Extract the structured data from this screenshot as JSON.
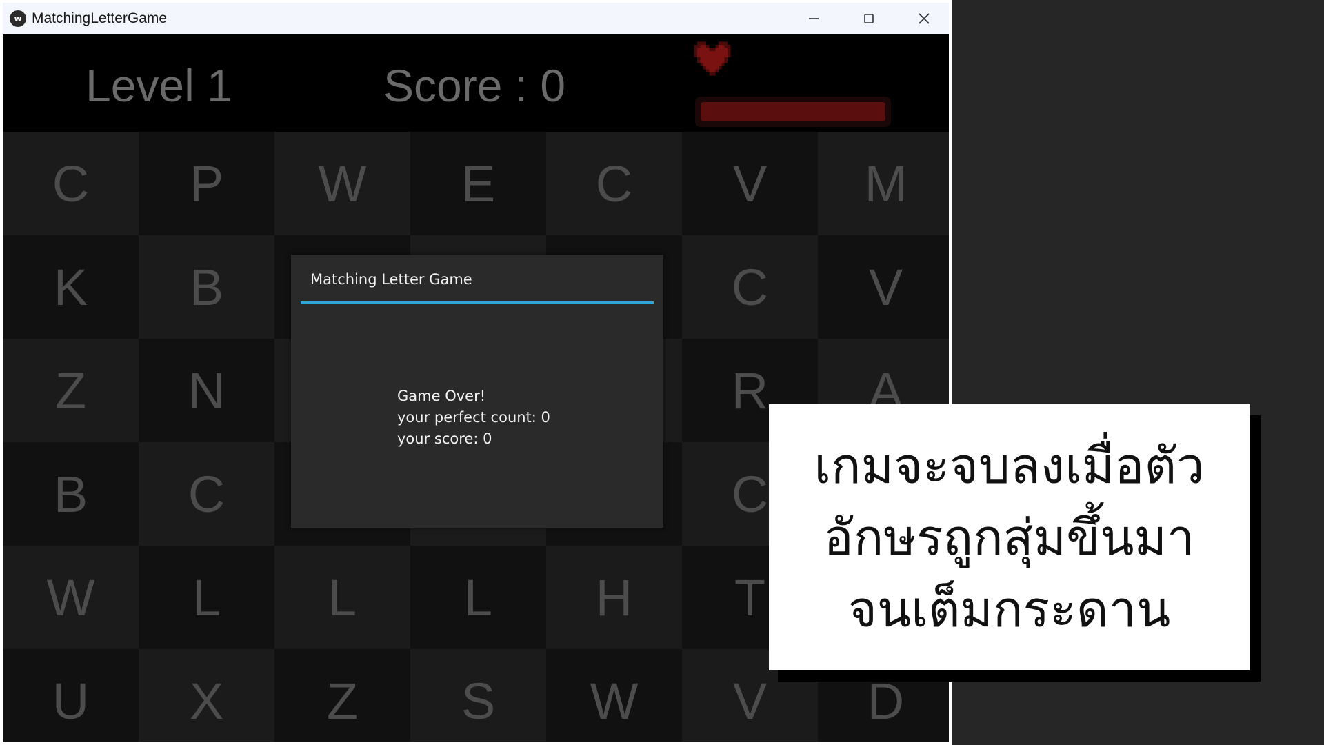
{
  "window": {
    "title": "MatchingLetterGame",
    "icon": "app-logo-icon",
    "controls": [
      "minimize-icon",
      "maximize-icon",
      "close-icon"
    ]
  },
  "hud": {
    "level": "Level 1",
    "score": "Score : 0",
    "heart_icon": "heart-icon"
  },
  "grid": {
    "rows": [
      [
        "C",
        "P",
        "W",
        "E",
        "C",
        "V",
        "M"
      ],
      [
        "K",
        "B",
        "",
        "",
        "",
        "C",
        "V"
      ],
      [
        "Z",
        "N",
        "",
        "",
        "",
        "R",
        "A"
      ],
      [
        "B",
        "C",
        "",
        "",
        "",
        "C",
        ""
      ],
      [
        "W",
        "L",
        "L",
        "L",
        "H",
        "T",
        ""
      ],
      [
        "U",
        "X",
        "Z",
        "S",
        "W",
        "V",
        "D"
      ]
    ]
  },
  "dialog": {
    "title": "Matching Letter Game",
    "message_line1": "Game Over!",
    "message_line2": "your perfect count: 0",
    "message_line3": "your score: 0",
    "accent_color": "#2fa6d8"
  },
  "caption": {
    "line1": "เกมจะจบลงเมื่อตัว",
    "line2": "อักษรถูกสุ่มขึ้นมา",
    "line3": "จนเต็มกระดาน"
  },
  "colors": {
    "health": "#5a0e0e",
    "panel": "#262626"
  }
}
